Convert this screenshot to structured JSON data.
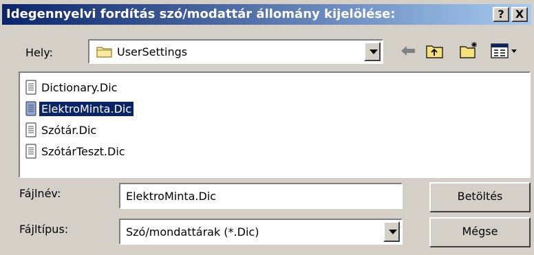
{
  "window": {
    "title": "Idegennyelvi fordítás szó/modattár állomány kijelölése:",
    "help_button": "?",
    "close_button": "X"
  },
  "location": {
    "label": "Hely:",
    "value": "UserSettings"
  },
  "toolbar": {
    "icons": [
      "back-arrow-icon",
      "up-folder-icon",
      "new-folder-icon",
      "view-menu-icon"
    ]
  },
  "files": [
    {
      "name": "Dictionary.Dic",
      "selected": false
    },
    {
      "name": "ElektroMinta.Dic",
      "selected": true
    },
    {
      "name": "Szótár.Dic",
      "selected": false
    },
    {
      "name": "SzótárTeszt.Dic",
      "selected": false
    }
  ],
  "filename": {
    "label": "Fájlnév:",
    "value": "ElektroMinta.Dic"
  },
  "filetype": {
    "label": "Fájltípus:",
    "value": "Szó/mondattárak (*.Dic)"
  },
  "buttons": {
    "open": "Betöltés",
    "cancel": "Mégse"
  },
  "colors": {
    "title_start": "#0a246a",
    "title_end": "#a6caf0",
    "face": "#d4d0c8",
    "selection": "#0a246a"
  }
}
